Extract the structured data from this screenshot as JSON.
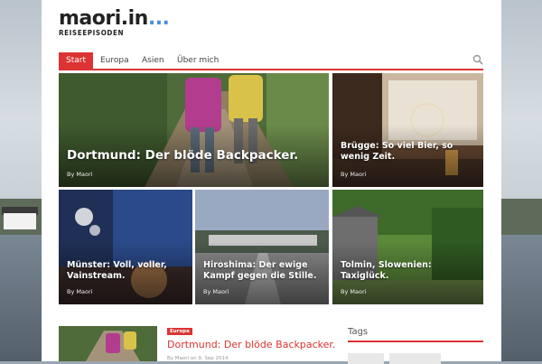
{
  "site": {
    "logo_main": "maori.in",
    "logo_dots": "...",
    "logo_sub": "REISEEPISODEN"
  },
  "nav": {
    "items": [
      {
        "label": "Start",
        "active": true
      },
      {
        "label": "Europa",
        "active": false
      },
      {
        "label": "Asien",
        "active": false
      },
      {
        "label": "Über mich",
        "active": false
      }
    ],
    "search_icon": "search-icon"
  },
  "tiles": [
    {
      "title": "Dortmund: Der blöde Backpacker.",
      "byline": "By Maori"
    },
    {
      "title": "Brügge: So viel Bier, so wenig Zeit.",
      "byline": "By Maori"
    },
    {
      "title": "Münster: Voll, voller, Vainstream.",
      "byline": "By Maori"
    },
    {
      "title": "Hiroshima: Der ewige Kampf gegen die Stille.",
      "byline": "By Maori"
    },
    {
      "title": "Tolmin, Slowenien: Taxiglück.",
      "byline": "By Maori"
    }
  ],
  "latest_post": {
    "category": "Europa",
    "title": "Dortmund: Der blöde Backpacker.",
    "meta": "By Maori on 9. Sep 2014"
  },
  "sidebar": {
    "tags_title": "Tags"
  },
  "colors": {
    "accent": "#dd3333",
    "logo_dots": "#4d8fd6"
  }
}
